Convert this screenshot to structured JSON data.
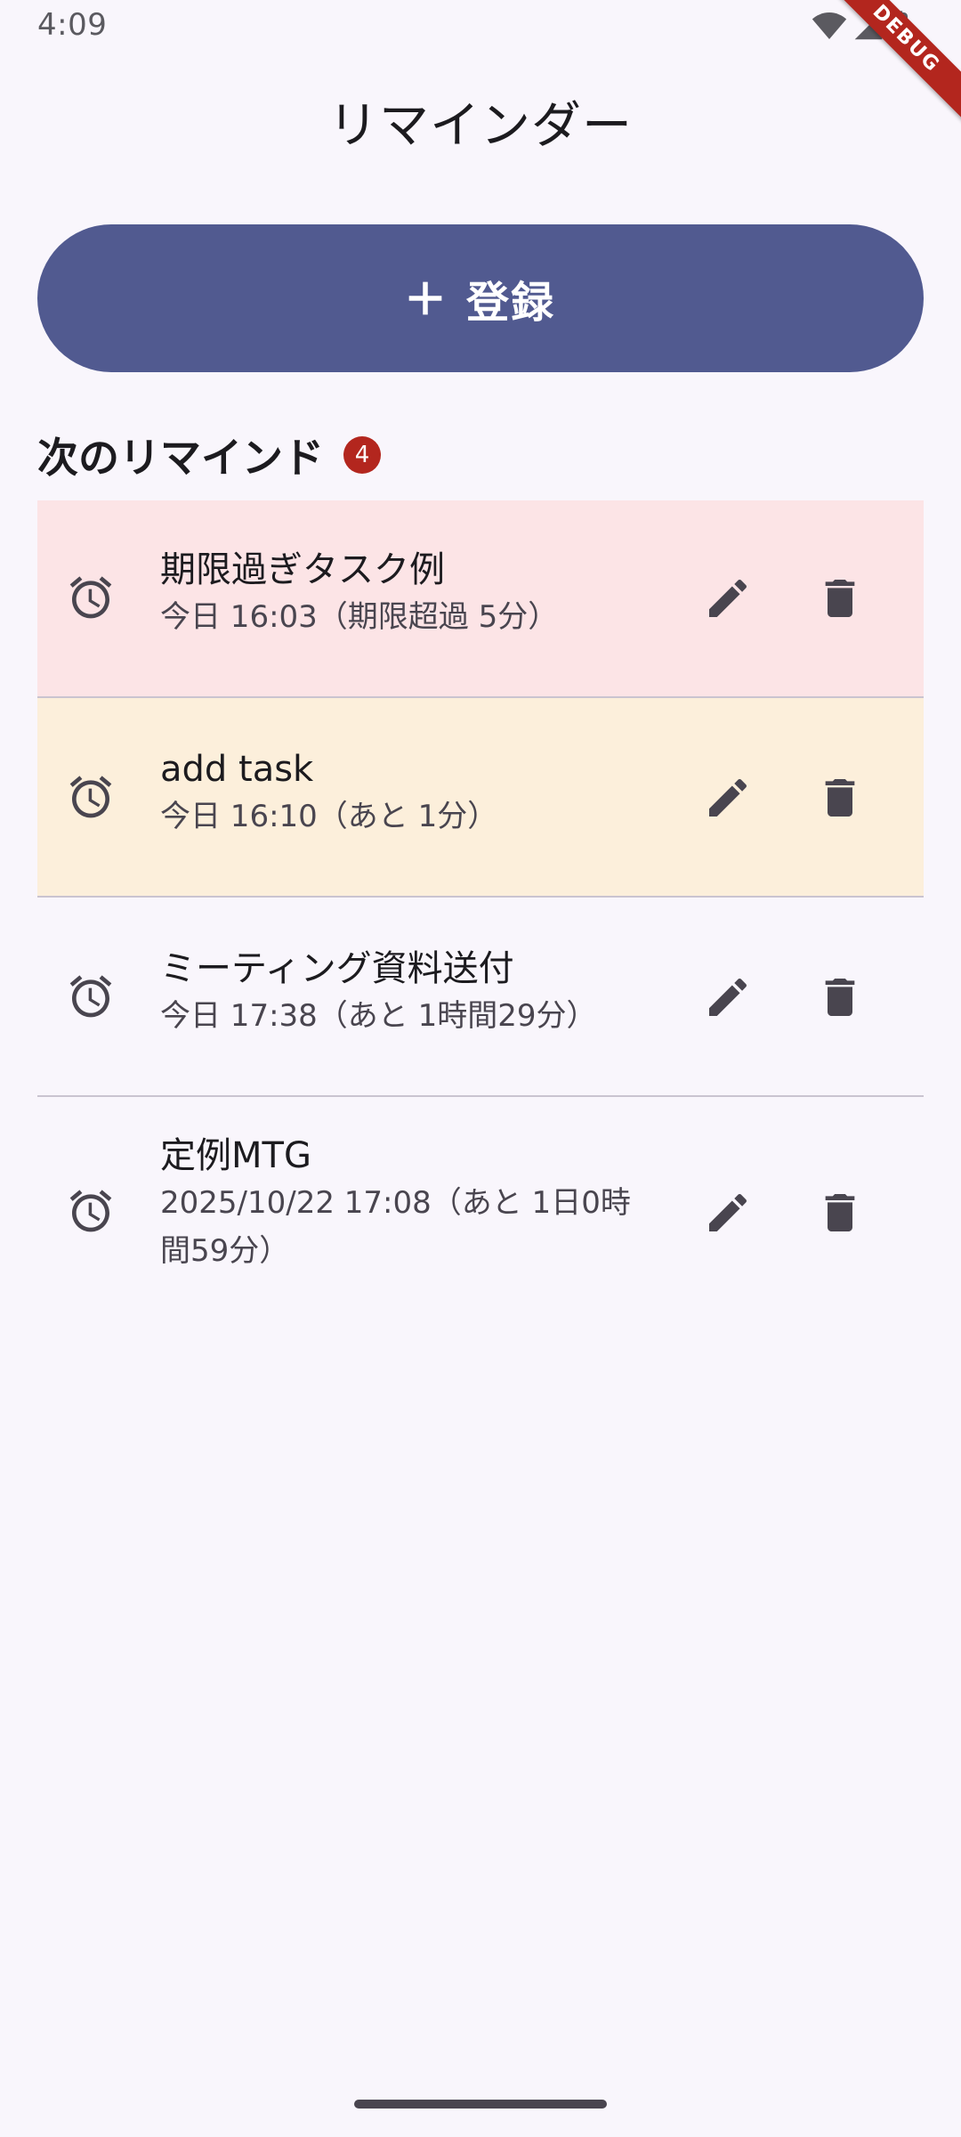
{
  "status_bar": {
    "time": "4:09"
  },
  "debug_banner": "DEBUG",
  "app": {
    "title": "リマインダー"
  },
  "register_button": {
    "label": "登録",
    "icon": "plus-icon"
  },
  "section": {
    "title": "次のリマインド",
    "count": "4"
  },
  "reminders": [
    {
      "title": "期限過ぎタスク例",
      "subtitle": "今日 16:03（期限超過 5分）",
      "status": "overdue",
      "background": "#fce4e6",
      "icon": "alarm-icon"
    },
    {
      "title": "add task",
      "subtitle": "今日 16:10（あと 1分）",
      "status": "soon",
      "background": "#fcefdb",
      "icon": "alarm-icon"
    },
    {
      "title": "ミーティング資料送付",
      "subtitle": "今日 17:38（あと 1時間29分）",
      "status": "normal",
      "background": "#f9f6fc",
      "icon": "alarm-icon"
    },
    {
      "title": "定例MTG",
      "subtitle": "2025/10/22 17:08（あと 1日0時間59分）",
      "status": "normal",
      "background": "#f9f6fc",
      "icon": "alarm-icon"
    }
  ],
  "colors": {
    "primary": "#515a90",
    "badge": "#b3261e",
    "overdue_bg": "#fce4e6",
    "soon_bg": "#fcefdb",
    "background": "#f9f6fc",
    "divider": "#cac4d0",
    "icon": "#49454f"
  }
}
